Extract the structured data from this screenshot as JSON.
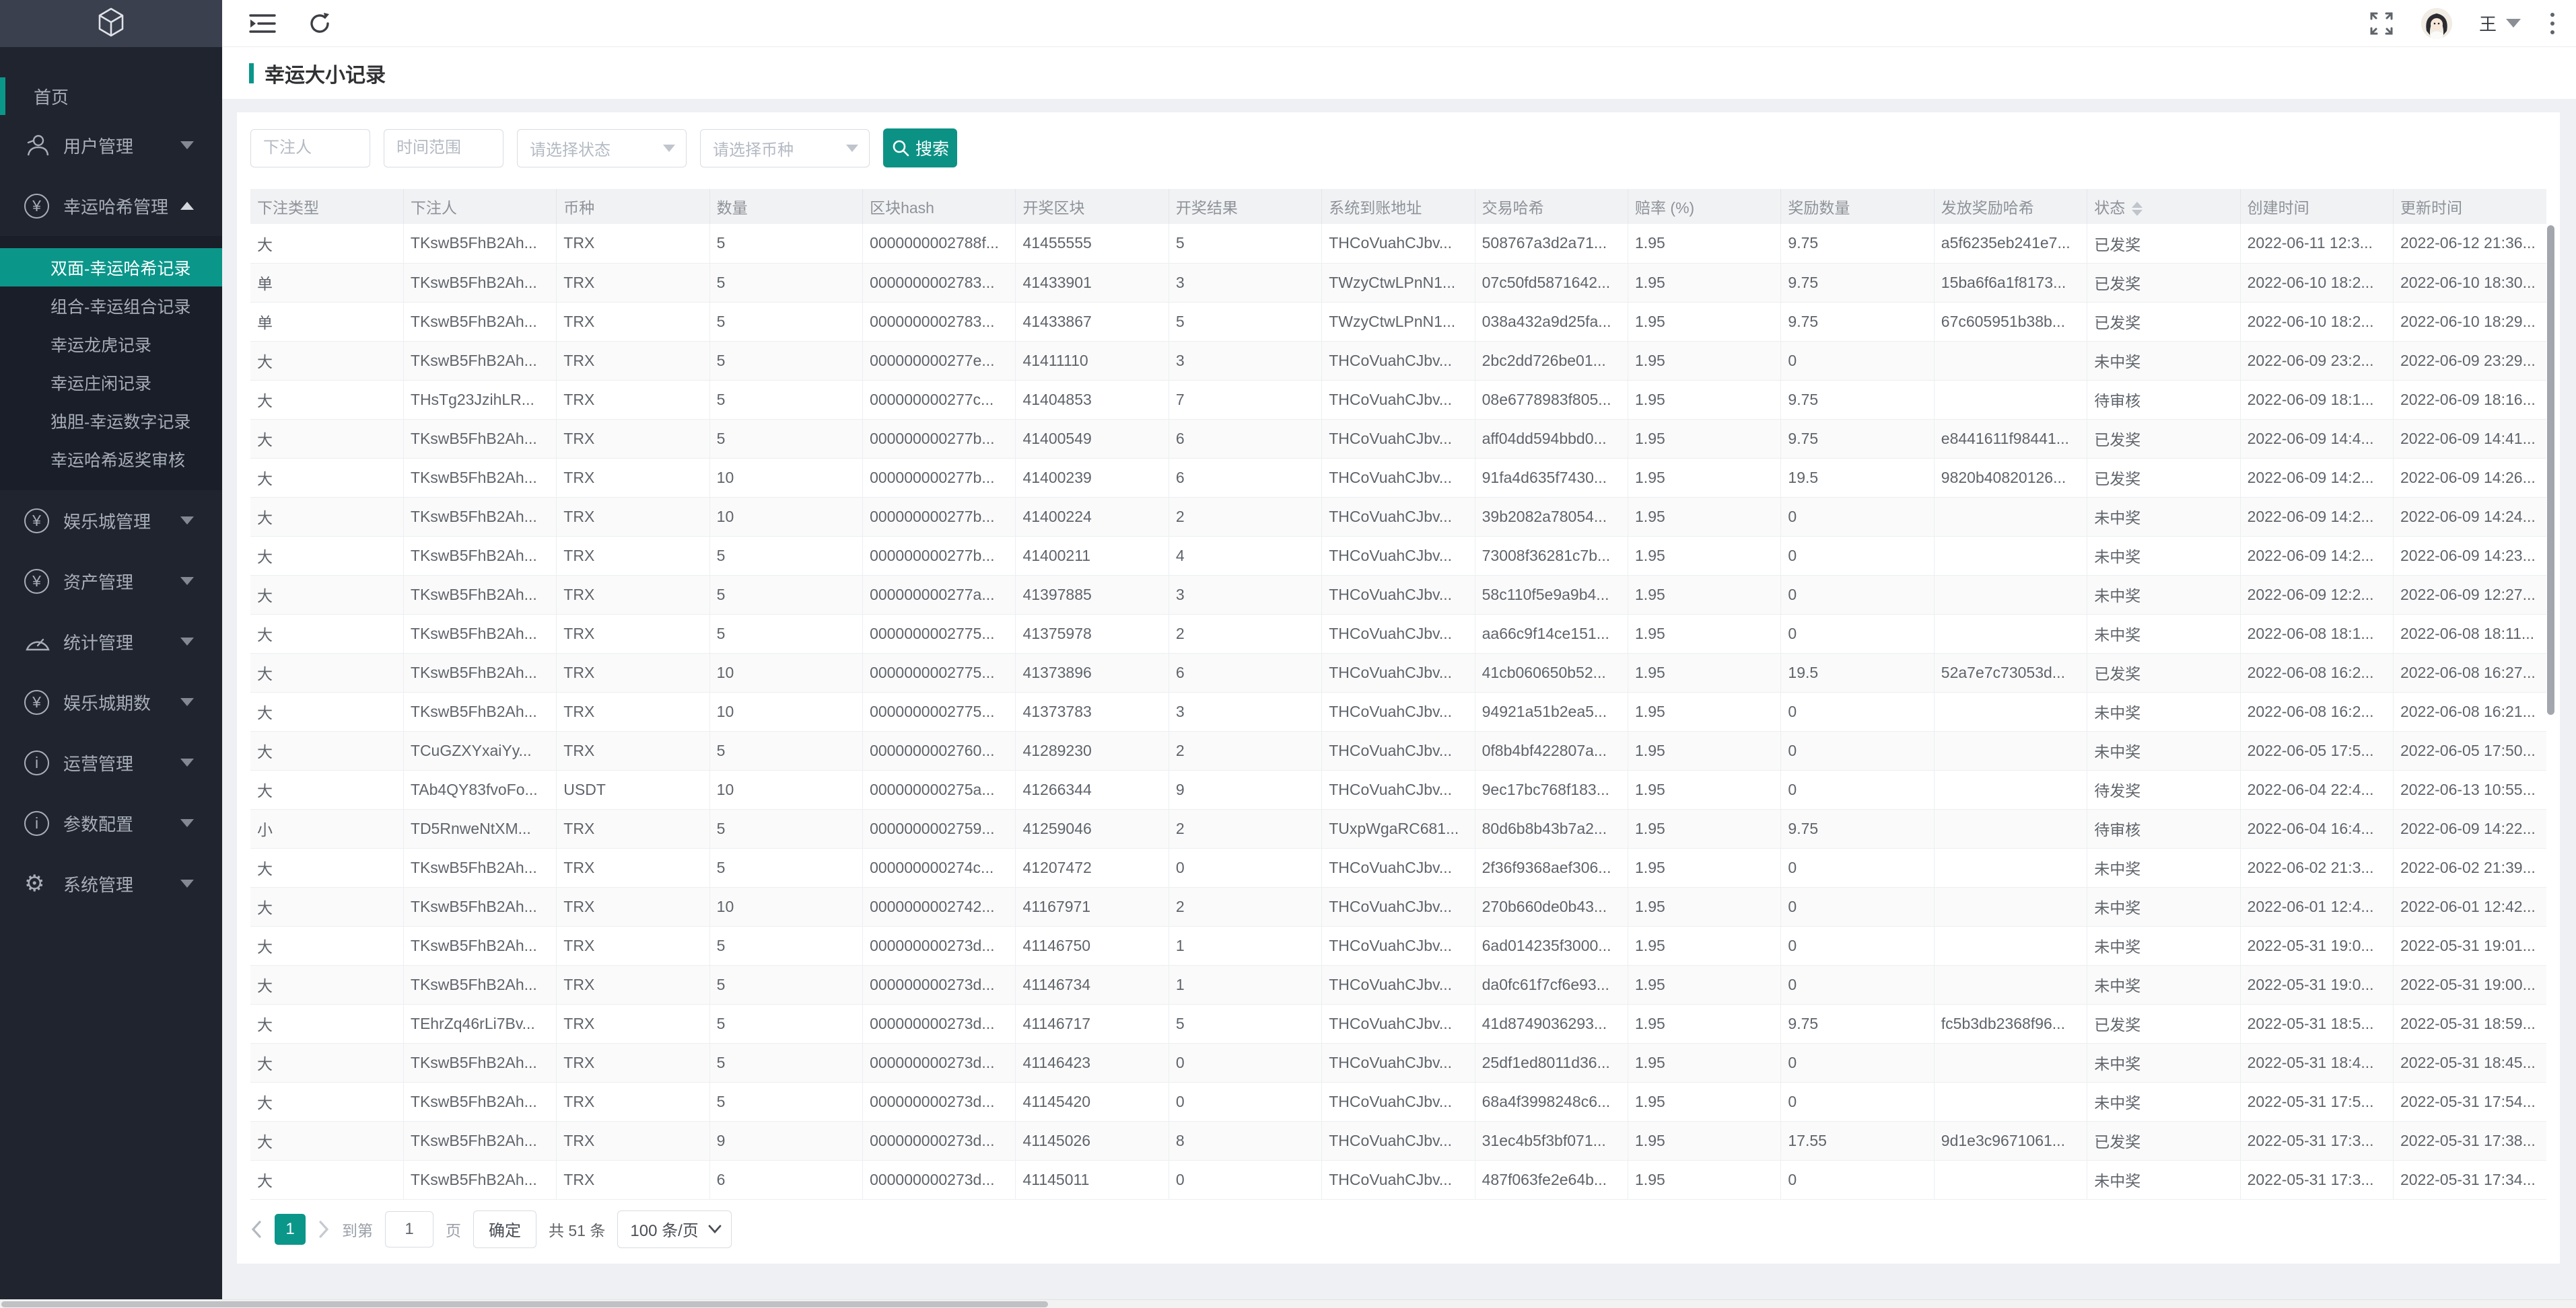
{
  "colors": {
    "accent": "#0b968a",
    "button_accent": "#0c9285",
    "sidebar_bg": "#20242f",
    "logo_strip_bg": "#3b404e"
  },
  "sidebar": {
    "logo_icon": "cube-logo-icon",
    "items": [
      {
        "key": "home",
        "type": "link",
        "label": "首页"
      },
      {
        "key": "user-management",
        "type": "group",
        "icon": "user-icon",
        "label": "用户管理",
        "state": "collapsed"
      },
      {
        "key": "lucky-hash-management",
        "type": "group",
        "icon": "yen-circle-icon",
        "label": "幸运哈希管理",
        "state": "expanded",
        "children": [
          {
            "key": "double-lucky-hash-records",
            "label": "双面-幸运哈希记录",
            "active": true
          },
          {
            "key": "combo-lucky-combo-records",
            "label": "组合-幸运组合记录",
            "active": false
          },
          {
            "key": "lucky-dragon-tiger-records",
            "label": "幸运龙虎记录",
            "active": false
          },
          {
            "key": "lucky-banker-player-records",
            "label": "幸运庄闲记录",
            "active": false
          },
          {
            "key": "single-lucky-number-records",
            "label": "独胆-幸运数字记录",
            "active": false
          },
          {
            "key": "lucky-hash-payout-review",
            "label": "幸运哈希返奖审核",
            "active": false
          }
        ]
      },
      {
        "key": "casino-management",
        "type": "group",
        "icon": "yen-circle-icon",
        "label": "娱乐城管理",
        "state": "collapsed"
      },
      {
        "key": "asset-management",
        "type": "group",
        "icon": "yen-circle-icon",
        "label": "资产管理",
        "state": "collapsed"
      },
      {
        "key": "statistics-management",
        "type": "group",
        "icon": "gauge-icon",
        "label": "统计管理",
        "state": "collapsed"
      },
      {
        "key": "casino-periods",
        "type": "group",
        "icon": "yen-circle-icon",
        "label": "娱乐城期数",
        "state": "collapsed"
      },
      {
        "key": "operations-management",
        "type": "group",
        "icon": "info-circle-icon",
        "label": "运营管理",
        "state": "collapsed"
      },
      {
        "key": "parameter-config",
        "type": "group",
        "icon": "info-circle-icon",
        "label": "参数配置",
        "state": "collapsed"
      },
      {
        "key": "system-management",
        "type": "group",
        "icon": "gear-icon",
        "label": "系统管理",
        "state": "collapsed"
      }
    ]
  },
  "topbar": {
    "left_icons": [
      "collapse-menu-icon",
      "refresh-icon"
    ],
    "right_icons": [
      "fullscreen-icon",
      "more-vertical-icon"
    ],
    "user_name": "王"
  },
  "page": {
    "title": "幸运大小记录"
  },
  "filters": {
    "bettor_placeholder": "下注人",
    "time_range_placeholder": "时间范围",
    "status_placeholder": "请选择状态",
    "coin_placeholder": "请选择币种",
    "search_label": "搜索"
  },
  "table": {
    "columns": [
      {
        "label": "下注类型",
        "sortable": false
      },
      {
        "label": "下注人",
        "sortable": false
      },
      {
        "label": "币种",
        "sortable": false
      },
      {
        "label": "数量",
        "sortable": false
      },
      {
        "label": "区块hash",
        "sortable": false
      },
      {
        "label": "开奖区块",
        "sortable": false
      },
      {
        "label": "开奖结果",
        "sortable": false
      },
      {
        "label": "系统到账地址",
        "sortable": false
      },
      {
        "label": "交易哈希",
        "sortable": false
      },
      {
        "label": "赔率 (%)",
        "sortable": false
      },
      {
        "label": "奖励数量",
        "sortable": false
      },
      {
        "label": "发放奖励哈希",
        "sortable": false
      },
      {
        "label": "状态",
        "sortable": true
      },
      {
        "label": "创建时间",
        "sortable": false
      },
      {
        "label": "更新时间",
        "sortable": false
      }
    ],
    "rows": [
      [
        "大",
        "TKswB5FhB2Ah...",
        "TRX",
        "5",
        "0000000002788f...",
        "41455555",
        "5",
        "THCoVuahCJbv...",
        "508767a3d2a71...",
        "1.95",
        "9.75",
        "a5f6235eb241e7...",
        "已发奖",
        "2022-06-11 12:3...",
        "2022-06-12 21:36..."
      ],
      [
        "单",
        "TKswB5FhB2Ah...",
        "TRX",
        "5",
        "0000000002783...",
        "41433901",
        "3",
        "TWzyCtwLPnN1...",
        "07c50fd5871642...",
        "1.95",
        "9.75",
        "15ba6f6a1f8173...",
        "已发奖",
        "2022-06-10 18:2...",
        "2022-06-10 18:30..."
      ],
      [
        "单",
        "TKswB5FhB2Ah...",
        "TRX",
        "5",
        "0000000002783...",
        "41433867",
        "5",
        "TWzyCtwLPnN1...",
        "038a432a9d25fa...",
        "1.95",
        "9.75",
        "67c605951b38b...",
        "已发奖",
        "2022-06-10 18:2...",
        "2022-06-10 18:29..."
      ],
      [
        "大",
        "TKswB5FhB2Ah...",
        "TRX",
        "5",
        "000000000277e...",
        "41411110",
        "3",
        "THCoVuahCJbv...",
        "2bc2dd726be01...",
        "1.95",
        "0",
        "",
        "未中奖",
        "2022-06-09 23:2...",
        "2022-06-09 23:29..."
      ],
      [
        "大",
        "THsTg23JzihLR...",
        "TRX",
        "5",
        "000000000277c...",
        "41404853",
        "7",
        "THCoVuahCJbv...",
        "08e6778983f805...",
        "1.95",
        "9.75",
        "",
        "待审核",
        "2022-06-09 18:1...",
        "2022-06-09 18:16..."
      ],
      [
        "大",
        "TKswB5FhB2Ah...",
        "TRX",
        "5",
        "000000000277b...",
        "41400549",
        "6",
        "THCoVuahCJbv...",
        "aff04dd594bbd0...",
        "1.95",
        "9.75",
        "e8441611f98441...",
        "已发奖",
        "2022-06-09 14:4...",
        "2022-06-09 14:41..."
      ],
      [
        "大",
        "TKswB5FhB2Ah...",
        "TRX",
        "10",
        "000000000277b...",
        "41400239",
        "6",
        "THCoVuahCJbv...",
        "91fa4d635f7430...",
        "1.95",
        "19.5",
        "9820b40820126...",
        "已发奖",
        "2022-06-09 14:2...",
        "2022-06-09 14:26..."
      ],
      [
        "大",
        "TKswB5FhB2Ah...",
        "TRX",
        "10",
        "000000000277b...",
        "41400224",
        "2",
        "THCoVuahCJbv...",
        "39b2082a78054...",
        "1.95",
        "0",
        "",
        "未中奖",
        "2022-06-09 14:2...",
        "2022-06-09 14:24..."
      ],
      [
        "大",
        "TKswB5FhB2Ah...",
        "TRX",
        "5",
        "000000000277b...",
        "41400211",
        "4",
        "THCoVuahCJbv...",
        "73008f36281c7b...",
        "1.95",
        "0",
        "",
        "未中奖",
        "2022-06-09 14:2...",
        "2022-06-09 14:23..."
      ],
      [
        "大",
        "TKswB5FhB2Ah...",
        "TRX",
        "5",
        "000000000277a...",
        "41397885",
        "3",
        "THCoVuahCJbv...",
        "58c110f5e9a9b4...",
        "1.95",
        "0",
        "",
        "未中奖",
        "2022-06-09 12:2...",
        "2022-06-09 12:27..."
      ],
      [
        "大",
        "TKswB5FhB2Ah...",
        "TRX",
        "5",
        "0000000002775...",
        "41375978",
        "2",
        "THCoVuahCJbv...",
        "aa66c9f14ce151...",
        "1.95",
        "0",
        "",
        "未中奖",
        "2022-06-08 18:1...",
        "2022-06-08 18:11..."
      ],
      [
        "大",
        "TKswB5FhB2Ah...",
        "TRX",
        "10",
        "0000000002775...",
        "41373896",
        "6",
        "THCoVuahCJbv...",
        "41cb060650b52...",
        "1.95",
        "19.5",
        "52a7e7c73053d...",
        "已发奖",
        "2022-06-08 16:2...",
        "2022-06-08 16:27..."
      ],
      [
        "大",
        "TKswB5FhB2Ah...",
        "TRX",
        "10",
        "0000000002775...",
        "41373783",
        "3",
        "THCoVuahCJbv...",
        "94921a51b2ea5...",
        "1.95",
        "0",
        "",
        "未中奖",
        "2022-06-08 16:2...",
        "2022-06-08 16:21..."
      ],
      [
        "大",
        "TCuGZXYxaiYy...",
        "TRX",
        "5",
        "0000000002760...",
        "41289230",
        "2",
        "THCoVuahCJbv...",
        "0f8b4bf422807a...",
        "1.95",
        "0",
        "",
        "未中奖",
        "2022-06-05 17:5...",
        "2022-06-05 17:50..."
      ],
      [
        "大",
        "TAb4QY83fvoFo...",
        "USDT",
        "10",
        "000000000275a...",
        "41266344",
        "9",
        "THCoVuahCJbv...",
        "9ec17bc768f183...",
        "1.95",
        "0",
        "",
        "待发奖",
        "2022-06-04 22:4...",
        "2022-06-13 10:55..."
      ],
      [
        "小",
        "TD5RnweNtXM...",
        "TRX",
        "5",
        "0000000002759...",
        "41259046",
        "2",
        "TUxpWgaRC681...",
        "80d6b8b43b7a2...",
        "1.95",
        "9.75",
        "",
        "待审核",
        "2022-06-04 16:4...",
        "2022-06-09 14:22..."
      ],
      [
        "大",
        "TKswB5FhB2Ah...",
        "TRX",
        "5",
        "000000000274c...",
        "41207472",
        "0",
        "THCoVuahCJbv...",
        "2f36f9368aef306...",
        "1.95",
        "0",
        "",
        "未中奖",
        "2022-06-02 21:3...",
        "2022-06-02 21:39..."
      ],
      [
        "大",
        "TKswB5FhB2Ah...",
        "TRX",
        "10",
        "0000000002742...",
        "41167971",
        "2",
        "THCoVuahCJbv...",
        "270b660de0b43...",
        "1.95",
        "0",
        "",
        "未中奖",
        "2022-06-01 12:4...",
        "2022-06-01 12:42..."
      ],
      [
        "大",
        "TKswB5FhB2Ah...",
        "TRX",
        "5",
        "000000000273d...",
        "41146750",
        "1",
        "THCoVuahCJbv...",
        "6ad014235f3000...",
        "1.95",
        "0",
        "",
        "未中奖",
        "2022-05-31 19:0...",
        "2022-05-31 19:01..."
      ],
      [
        "大",
        "TKswB5FhB2Ah...",
        "TRX",
        "5",
        "000000000273d...",
        "41146734",
        "1",
        "THCoVuahCJbv...",
        "da0fc61f7cf6e93...",
        "1.95",
        "0",
        "",
        "未中奖",
        "2022-05-31 19:0...",
        "2022-05-31 19:00..."
      ],
      [
        "大",
        "TEhrZq46rLi7Bv...",
        "TRX",
        "5",
        "000000000273d...",
        "41146717",
        "5",
        "THCoVuahCJbv...",
        "41d8749036293...",
        "1.95",
        "9.75",
        "fc5b3db2368f96...",
        "已发奖",
        "2022-05-31 18:5...",
        "2022-05-31 18:59..."
      ],
      [
        "大",
        "TKswB5FhB2Ah...",
        "TRX",
        "5",
        "000000000273d...",
        "41146423",
        "0",
        "THCoVuahCJbv...",
        "25df1ed8011d36...",
        "1.95",
        "0",
        "",
        "未中奖",
        "2022-05-31 18:4...",
        "2022-05-31 18:45..."
      ],
      [
        "大",
        "TKswB5FhB2Ah...",
        "TRX",
        "5",
        "000000000273d...",
        "41145420",
        "0",
        "THCoVuahCJbv...",
        "68a4f3998248c6...",
        "1.95",
        "0",
        "",
        "未中奖",
        "2022-05-31 17:5...",
        "2022-05-31 17:54..."
      ],
      [
        "大",
        "TKswB5FhB2Ah...",
        "TRX",
        "9",
        "000000000273d...",
        "41145026",
        "8",
        "THCoVuahCJbv...",
        "31ec4b5f3bf071...",
        "1.95",
        "17.55",
        "9d1e3c9671061...",
        "已发奖",
        "2022-05-31 17:3...",
        "2022-05-31 17:38..."
      ],
      [
        "大",
        "TKswB5FhB2Ah...",
        "TRX",
        "6",
        "000000000273d...",
        "41145011",
        "0",
        "THCoVuahCJbv...",
        "487f063fe2e64b...",
        "1.95",
        "0",
        "",
        "未中奖",
        "2022-05-31 17:3...",
        "2022-05-31 17:34..."
      ]
    ]
  },
  "pagination": {
    "active_page": "1",
    "jump_prefix": "到第",
    "jump_value": "1",
    "jump_suffix": "页",
    "confirm_label": "确定",
    "total_label": "共 51 条",
    "page_size_label": "100 条/页"
  }
}
